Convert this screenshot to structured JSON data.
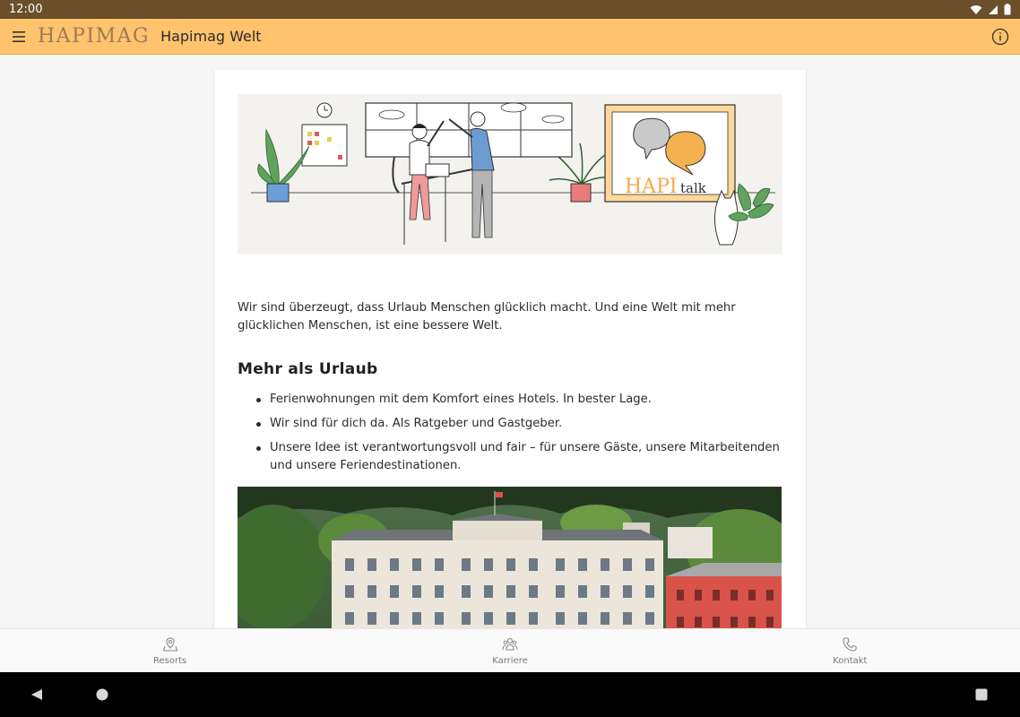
{
  "status": {
    "time": "12:00"
  },
  "header": {
    "logo": "HAPIMAG",
    "title": "Hapimag Welt"
  },
  "hero": {
    "brand_hapi": "HAPI",
    "brand_talk": "talk"
  },
  "intro": "Wir sind überzeugt, dass Urlaub Menschen glücklich macht. Und eine Welt mit mehr glücklichen Menschen, ist eine bessere Welt.",
  "section": {
    "title": "Mehr als Urlaub",
    "bullets": [
      "Ferienwohnungen mit dem Komfort eines Hotels. In bester Lage.",
      "Wir sind für dich da. Als Ratgeber und Gastgeber.",
      "Unsere Idee ist verantwortungsvoll und fair – für unsere Gäste, unsere Mitarbeitenden und unsere Feriendestinationen."
    ]
  },
  "bottom_nav": [
    {
      "label": "Resorts",
      "icon": "map-pin-icon"
    },
    {
      "label": "Karriere",
      "icon": "people-icon"
    },
    {
      "label": "Kontakt",
      "icon": "phone-icon"
    }
  ],
  "colors": {
    "status_bar": "#6b4f2a",
    "app_bar": "#ffc36e",
    "logo": "#9a7a55",
    "accent_orange": "#f5a94a"
  }
}
